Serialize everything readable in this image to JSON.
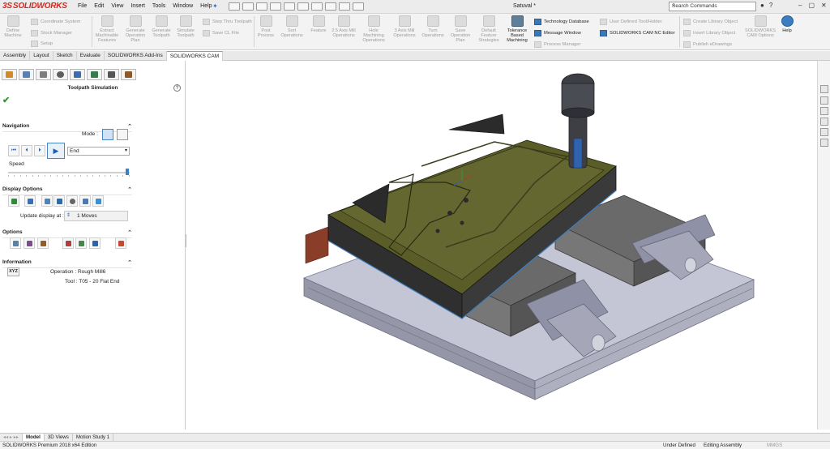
{
  "app": {
    "logo": "SOLIDWORKS",
    "logo_prefix": "3S",
    "doc_title": "Satuval *",
    "search_placeholder": "Search Commands",
    "menu": [
      "File",
      "Edit",
      "View",
      "Insert",
      "Tools",
      "Window",
      "Help"
    ]
  },
  "ribbon": {
    "define_machine": "Define Machine",
    "coordinate_system": "Coordinate System",
    "stock_manager": "Stock Manager",
    "setup": "Setup",
    "extract_features": "Extract Machinable Features",
    "generate_operation_plan": "Generate Operation Plan",
    "generate_toolpath": "Generate Toolpath",
    "simulate_toolpath": "Simulate Toolpath",
    "step_thru_toolpath": "Step Thru Toolpath",
    "save_cl_file": "Save CL File",
    "post_process": "Post Process",
    "sort_operations": "Sort Operations",
    "feature": "Feature",
    "axis25": "2.5 Axis Mill Operations",
    "hole_machining": "Hole Machining Operations",
    "axis3": "3 Axis Mill Operations",
    "turn_operations": "Turn Operations",
    "save_operation_plan": "Save Operation Plan",
    "default_feature_strategies": "Default Feature Strategies",
    "tolerance_based": "Tolerance Based Machining",
    "technology_database": "Technology Database",
    "message_window": "Message Window",
    "process_manager": "Process Manager",
    "user_defined_tool": "User Defined Tool/Holder",
    "nc_editor": "SOLIDWORKS CAM NC Editor",
    "create_library": "Create Library Object",
    "insert_library": "Insert Library Object",
    "publish_edrawings": "Publish eDrawings",
    "cam_options": "SOLIDWORKS CAM Options",
    "help": "Help"
  },
  "tabs": [
    "Assembly",
    "Layout",
    "Sketch",
    "Evaluate",
    "SOLIDWORKS Add-Ins",
    "SOLIDWORKS CAM"
  ],
  "active_tab": "SOLIDWORKS CAM",
  "panel": {
    "title": "Toolpath Simulation",
    "help_label": "?",
    "navigation": {
      "header": "Navigation",
      "mode_label": "Mode :",
      "end_value": "End",
      "speed_label": "Speed",
      "speed_level": 0.98
    },
    "display": {
      "header": "Display Options",
      "update_label": "Update display at :",
      "update_value": "1 Moves"
    },
    "options": {
      "header": "Options"
    },
    "information": {
      "header": "Information",
      "xyz": "XYZ",
      "operation": "Operation : Rough Mill6",
      "tool": "Tool : T05 - 20 Flat End"
    }
  },
  "bottom_tabs": [
    "Model",
    "3D Views",
    "Motion Study 1"
  ],
  "status": {
    "left": "SOLIDWORKS Premium 2018 x64 Edition",
    "defined": "Under Defined",
    "mode": "Editing Assembly",
    "units": "MMGS"
  },
  "colors": {
    "accent": "#3c7fc2",
    "brand": "#d8261e",
    "part_top": "#4e5220",
    "part_side": "#2d2d2d",
    "vise": "#9d9fb2"
  }
}
